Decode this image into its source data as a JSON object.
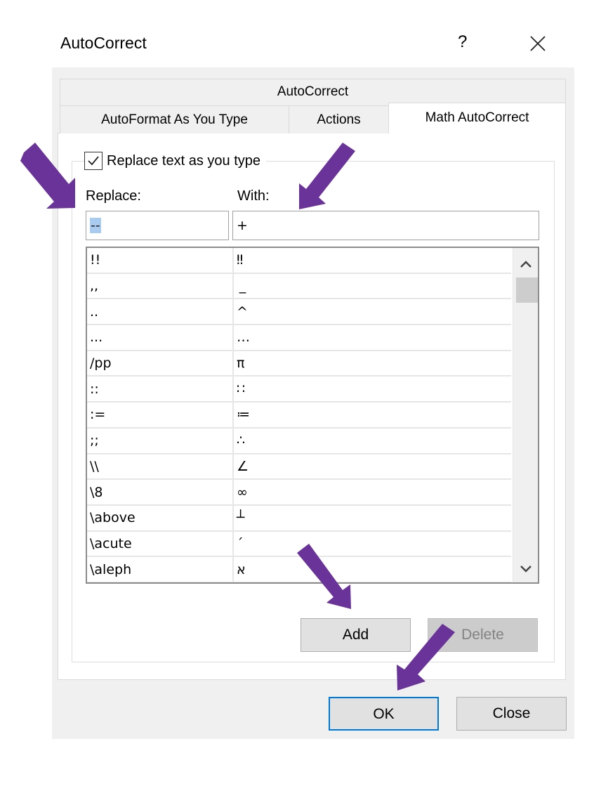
{
  "window": {
    "title": "AutoCorrect",
    "help_label": "?",
    "close_icon": "close-x-icon"
  },
  "tabs": {
    "top_row": [
      {
        "label": "AutoCorrect",
        "active": false
      }
    ],
    "bottom_row": [
      {
        "label": "AutoFormat As You Type",
        "active": false
      },
      {
        "label": "Actions",
        "active": false
      },
      {
        "label": "Math AutoCorrect",
        "active": true
      }
    ]
  },
  "panel": {
    "replace_checkbox": {
      "label": "Replace text as you type",
      "checked": true
    },
    "replace_label": "Replace:",
    "with_label": "With:",
    "replace_value": "--",
    "with_value": "+",
    "entries": [
      {
        "replace": "!!",
        "with": "‼"
      },
      {
        "replace": ",,",
        "with": " _"
      },
      {
        "replace": "..",
        "with": "^"
      },
      {
        "replace": "...",
        "with": "…"
      },
      {
        "replace": "/pp",
        "with": "π"
      },
      {
        "replace": "::",
        "with": "∷"
      },
      {
        "replace": ":=",
        "with": "≔"
      },
      {
        "replace": ";;",
        "with": "∴"
      },
      {
        "replace": "\\\\",
        "with": "∠"
      },
      {
        "replace": "\\8",
        "with": "∞"
      },
      {
        "replace": "\\above",
        "with": "┴"
      },
      {
        "replace": "\\acute",
        "with": "´"
      },
      {
        "replace": "\\aleph",
        "with": "א"
      }
    ],
    "scroll_position": 0.0,
    "add_label": "Add",
    "delete_label": "Delete",
    "delete_enabled": false
  },
  "footer": {
    "ok_label": "OK",
    "close_label": "Close"
  },
  "annotations": {
    "arrow_color": "#6a3399",
    "arrow_targets": [
      "replace-input",
      "with-input",
      "add-button",
      "ok-button"
    ]
  }
}
